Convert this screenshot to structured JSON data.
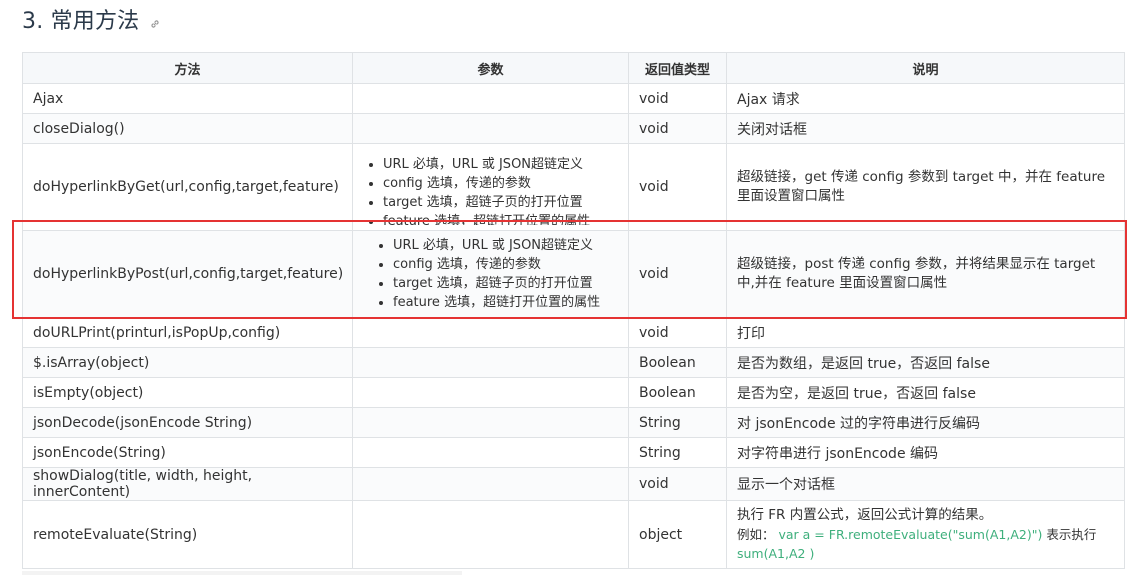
{
  "heading": {
    "title": "3. 常用方法",
    "anchor_icon": "link-icon"
  },
  "table": {
    "headers": [
      "方法",
      "参数",
      "返回值类型",
      "说明"
    ],
    "rows": [
      {
        "method": "Ajax",
        "params": [],
        "ret": "void",
        "desc": "Ajax 请求"
      },
      {
        "method": "closeDialog()",
        "params": [],
        "ret": "void",
        "desc": "关闭对话框"
      },
      {
        "method": "doHyperlinkByGet(url,config,target,feature)",
        "params": [
          "URL 必填，URL 或 JSON超链定义",
          "config 选填，传递的参数",
          "target 选填，超链子页的打开位置",
          "feature 选填，超链打开位置的属性"
        ],
        "ret": "void",
        "desc": "超级链接，get 传递 config 参数到 target 中，并在 feature 里面设置窗口属性"
      },
      {
        "method": "doHyperlinkByPost(url,config,target,feature)",
        "params": [
          "URL 必填，URL 或 JSON超链定义",
          "config 选填，传递的参数",
          "target 选填，超链子页的打开位置",
          "feature 选填，超链打开位置的属性"
        ],
        "ret": "void",
        "desc": "超级链接，post 传递 config 参数，并将结果显示在 target 中,并在 feature 里面设置窗口属性"
      },
      {
        "method": "doURLPrint(printurl,isPopUp,config)",
        "params": [],
        "ret": "void",
        "desc": "打印"
      },
      {
        "method": "$.isArray(object)",
        "params": [],
        "ret": "Boolean",
        "desc": "是否为数组，是返回 true，否返回 false"
      },
      {
        "method": "isEmpty(object)",
        "params": [],
        "ret": "Boolean",
        "desc": "是否为空，是返回 true，否返回 false"
      },
      {
        "method": "jsonDecode(jsonEncode String)",
        "params": [],
        "ret": "String",
        "desc": "对 jsonEncode 过的字符串进行反编码"
      },
      {
        "method": "jsonEncode(String)",
        "params": [],
        "ret": "String",
        "desc": "对字符串进行 jsonEncode 编码"
      },
      {
        "method": "showDialog(title, width, height, innerContent)",
        "params": [],
        "ret": "void",
        "desc": "显示一个对话框"
      },
      {
        "method": "remoteEvaluate(String)",
        "params": [],
        "ret": "object",
        "desc_line1": "执行 FR 内置公式，返回公式计算的结果。",
        "desc_example_prefix": "例如：",
        "desc_code": "var a = FR.remoteEvaluate(\"sum(A1,A2)\")",
        "desc_suffix": "表示执行",
        "desc_code2": "sum(A1,A2 )"
      }
    ]
  },
  "colors": {
    "highlight": "#e53333",
    "code": "#3eaf7c",
    "header_bg": "#f6f8fa",
    "border": "#dfe2e5"
  }
}
